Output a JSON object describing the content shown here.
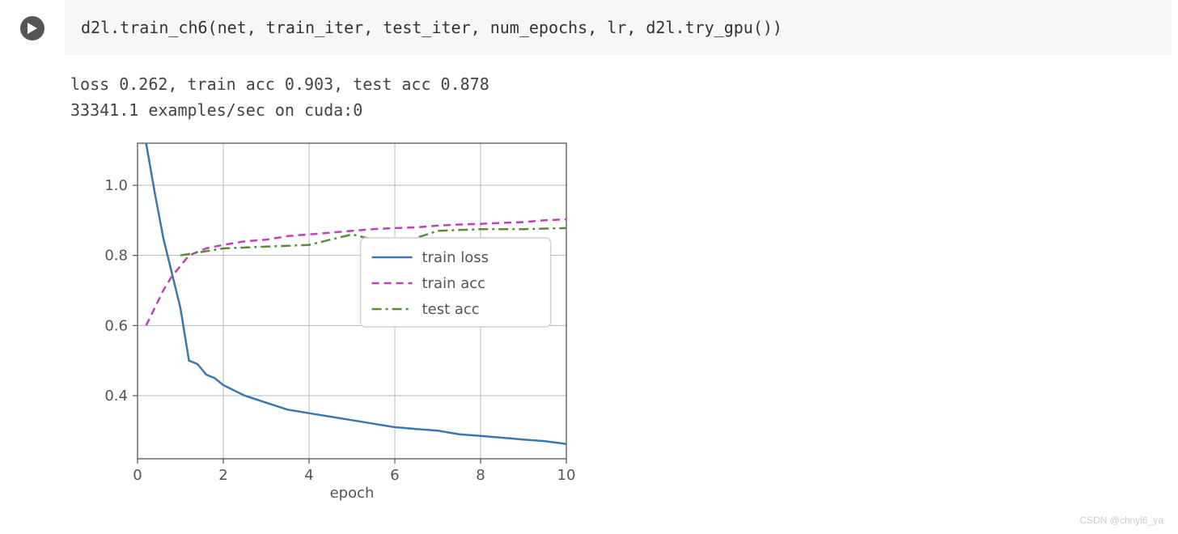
{
  "code": "d2l.train_ch6(net, train_iter, test_iter, num_epochs, lr, d2l.try_gpu())",
  "output_line1": "loss 0.262, train acc 0.903, test acc 0.878",
  "output_line2": "33341.1 examples/sec on cuda:0",
  "watermark": "CSDN @chnyi6_ya",
  "chart_data": {
    "type": "line",
    "xlabel": "epoch",
    "ylabel": "",
    "xlim": [
      0,
      10
    ],
    "ylim": [
      0.22,
      1.12
    ],
    "xticks": [
      0,
      2,
      4,
      6,
      8,
      10
    ],
    "yticks": [
      0.4,
      0.6,
      0.8,
      1.0
    ],
    "legend": {
      "position": "center-right",
      "entries": [
        "train loss",
        "train acc",
        "test acc"
      ]
    },
    "series": [
      {
        "name": "train loss",
        "color": "#3b77af",
        "style": "solid",
        "x": [
          0.2,
          0.4,
          0.6,
          0.8,
          1.0,
          1.2,
          1.4,
          1.6,
          1.8,
          2.0,
          2.5,
          3.0,
          3.5,
          4.0,
          4.5,
          5.0,
          5.5,
          6.0,
          6.5,
          7.0,
          7.5,
          8.0,
          8.5,
          9.0,
          9.5,
          10.0
        ],
        "y": [
          1.12,
          0.98,
          0.85,
          0.75,
          0.65,
          0.5,
          0.49,
          0.46,
          0.45,
          0.43,
          0.4,
          0.38,
          0.36,
          0.35,
          0.34,
          0.33,
          0.32,
          0.31,
          0.305,
          0.3,
          0.29,
          0.285,
          0.28,
          0.275,
          0.27,
          0.262
        ]
      },
      {
        "name": "train acc",
        "color": "#c23fba",
        "style": "dashed",
        "x": [
          0.2,
          0.4,
          0.6,
          0.8,
          1.0,
          1.2,
          1.4,
          1.6,
          1.8,
          2.0,
          2.5,
          3.0,
          3.5,
          4.0,
          4.5,
          5.0,
          5.5,
          6.0,
          6.5,
          7.0,
          7.5,
          8.0,
          8.5,
          9.0,
          9.5,
          10.0
        ],
        "y": [
          0.6,
          0.65,
          0.7,
          0.74,
          0.77,
          0.8,
          0.81,
          0.82,
          0.825,
          0.83,
          0.84,
          0.845,
          0.855,
          0.86,
          0.865,
          0.87,
          0.875,
          0.878,
          0.88,
          0.885,
          0.888,
          0.89,
          0.893,
          0.895,
          0.9,
          0.903
        ]
      },
      {
        "name": "test acc",
        "color": "#5a8a3a",
        "style": "dashdot",
        "x": [
          1.0,
          2.0,
          3.0,
          4.0,
          5.0,
          6.0,
          7.0,
          8.0,
          9.0,
          10.0
        ],
        "y": [
          0.8,
          0.82,
          0.825,
          0.83,
          0.86,
          0.83,
          0.87,
          0.875,
          0.875,
          0.878
        ]
      }
    ]
  }
}
